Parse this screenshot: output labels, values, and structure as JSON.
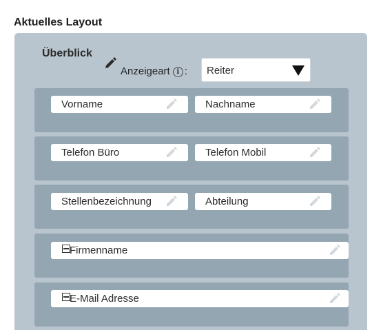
{
  "heading": "Aktuelles Layout",
  "overview": {
    "label": "Überblick",
    "display_type_label": "Anzeigeart",
    "info_icon": "i",
    "colon": ":",
    "display_type_value": "Reiter"
  },
  "rows": [
    {
      "fields": [
        {
          "label": "Vorname"
        },
        {
          "label": "Nachname"
        }
      ]
    },
    {
      "fields": [
        {
          "label": "Telefon Büro"
        },
        {
          "label": "Telefon Mobil"
        }
      ]
    },
    {
      "fields": [
        {
          "label": "Stellenbezeichnung"
        },
        {
          "label": "Abteilung"
        }
      ]
    },
    {
      "fields": [
        {
          "label": "Firmenname"
        }
      ]
    },
    {
      "fields": [
        {
          "label": "E-Mail Adresse"
        }
      ]
    }
  ],
  "icons": {
    "edit": "pencil-icon",
    "collapse": "collapse-icon",
    "dropdown": "triangle-down-icon",
    "info": "info-icon"
  },
  "colors": {
    "panel": "#b9c5ce",
    "row": "#95a6b3",
    "field": "#ffffff",
    "pencil_light": "#d4d9de",
    "pencil_dark": "#2a2a2a"
  }
}
